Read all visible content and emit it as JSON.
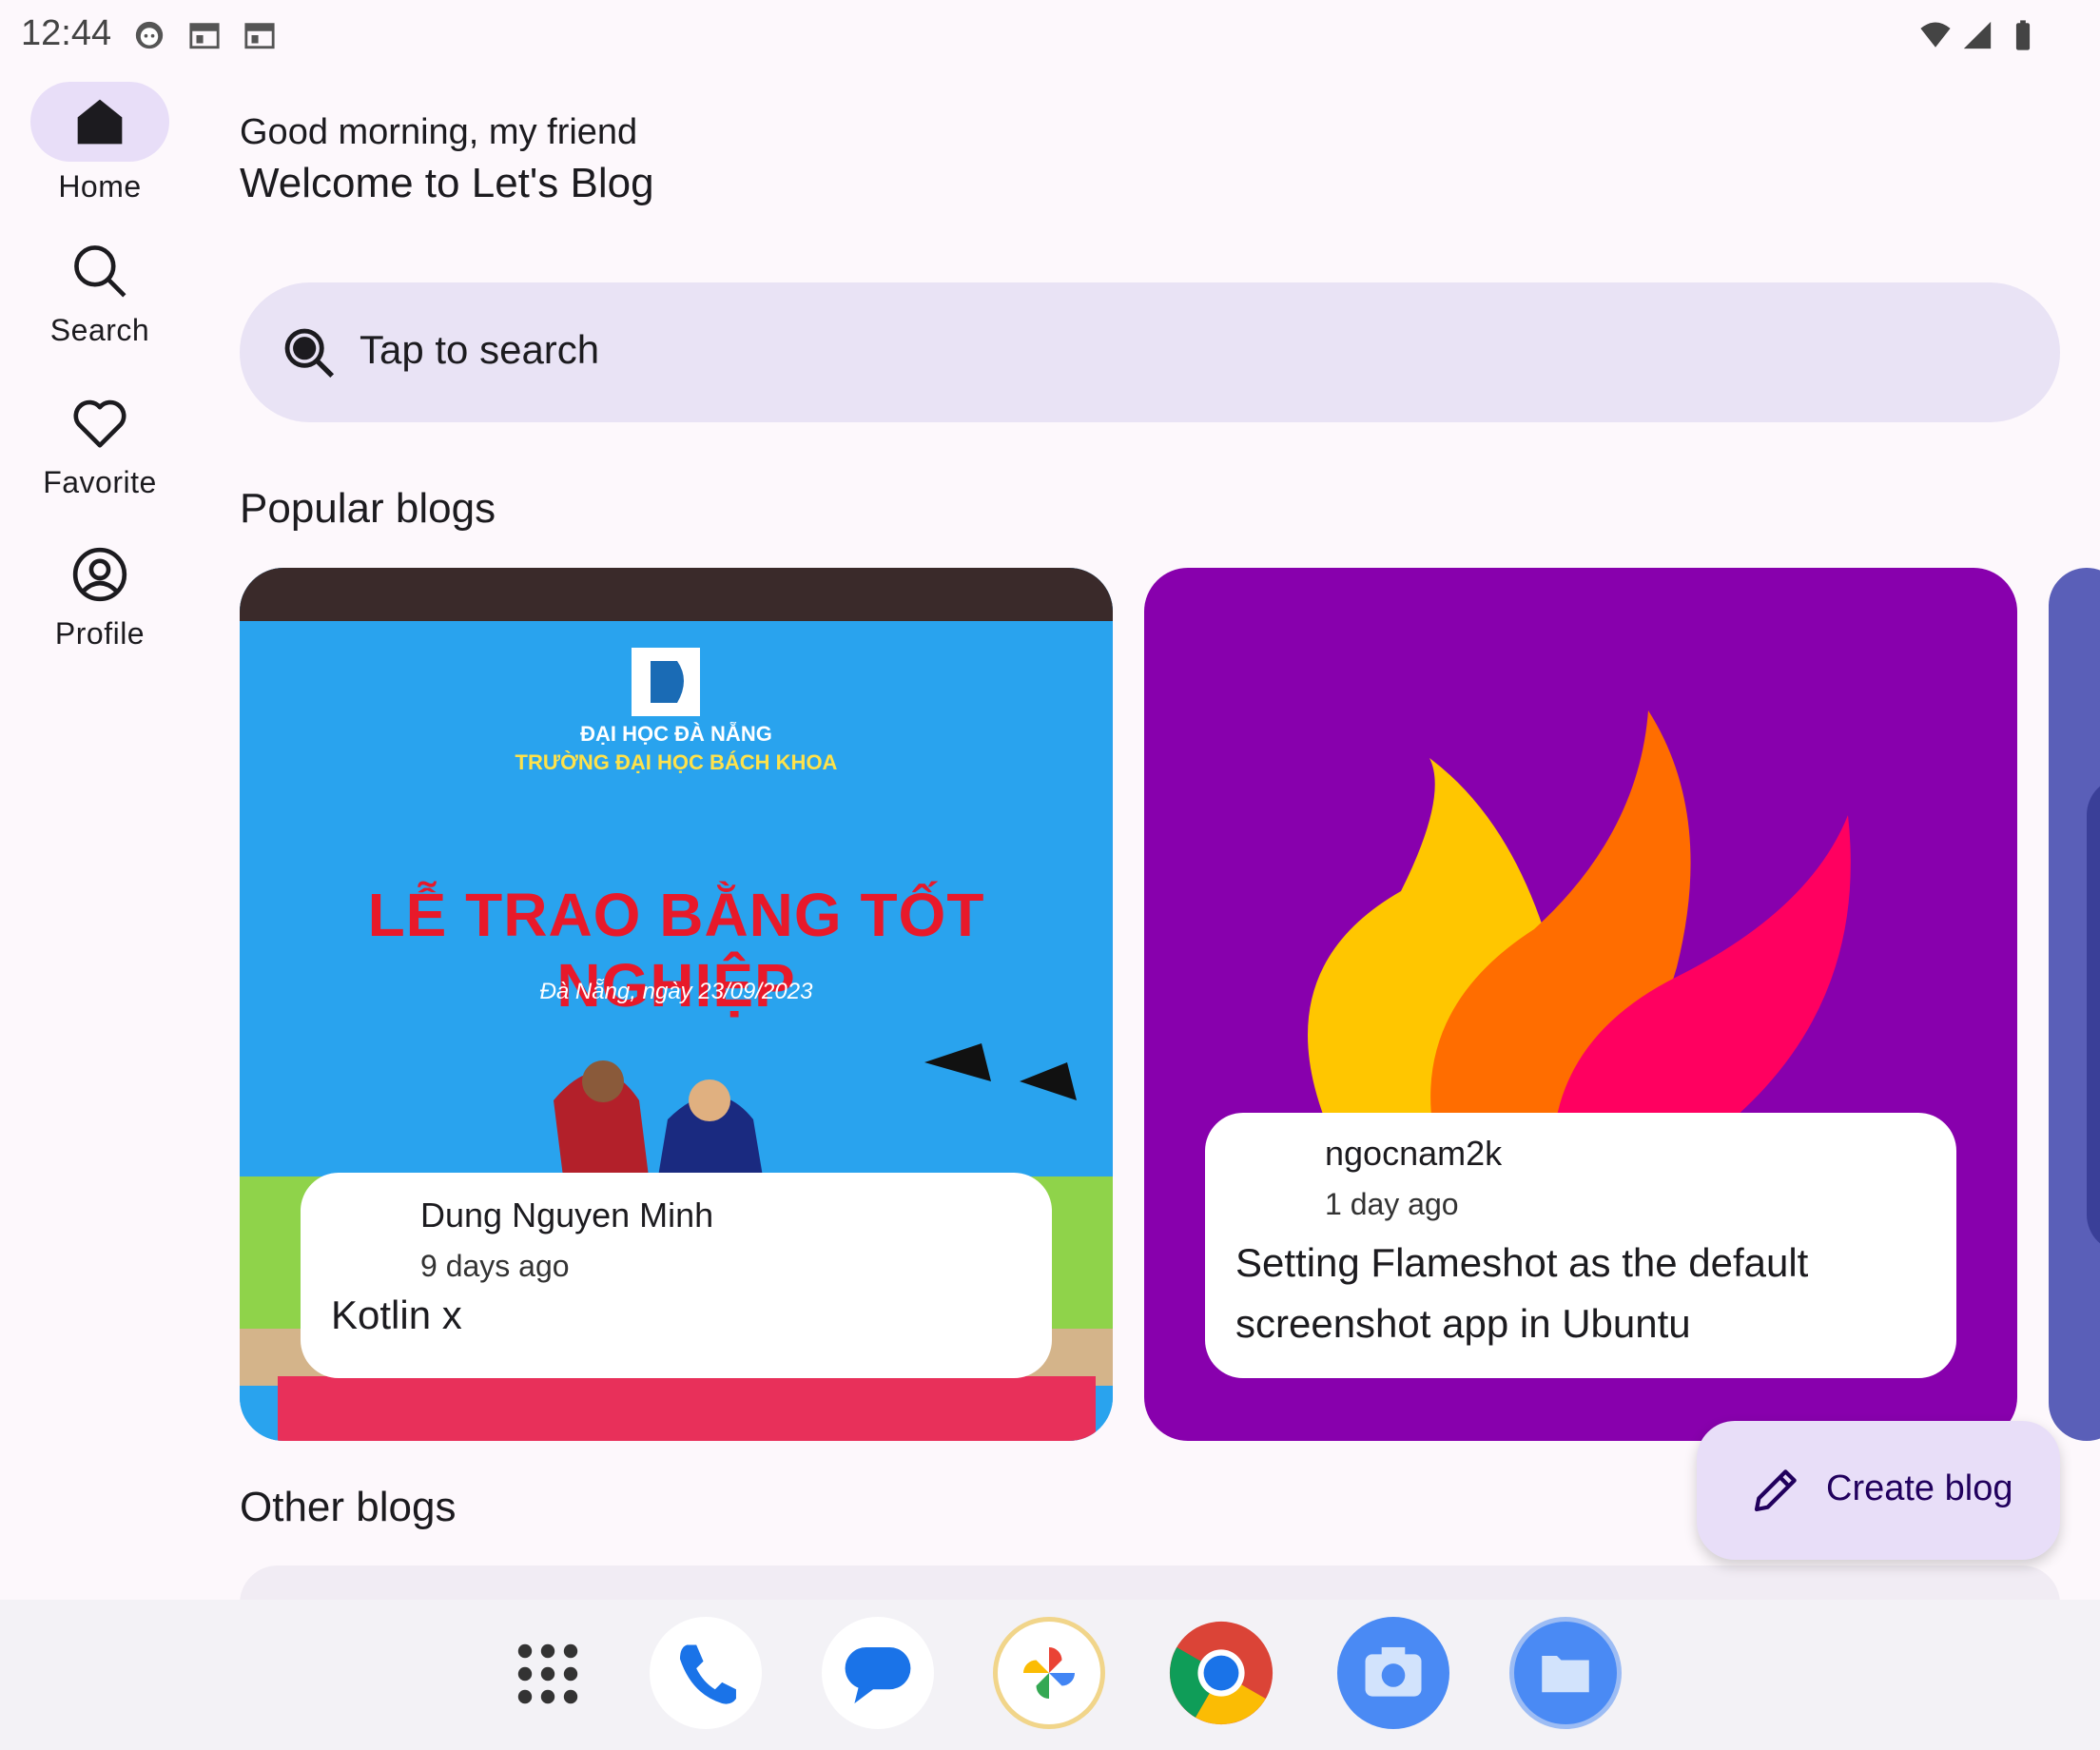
{
  "status_bar": {
    "time": "12:44",
    "icons": [
      "face-icon",
      "calendar-icon",
      "calendar-icon",
      "wifi-icon",
      "signal-icon",
      "battery-icon"
    ]
  },
  "nav": {
    "items": [
      {
        "label": "Home",
        "icon": "home-icon",
        "active": true
      },
      {
        "label": "Search",
        "icon": "search-icon"
      },
      {
        "label": "Favorite",
        "icon": "heart-icon"
      },
      {
        "label": "Profile",
        "icon": "profile-icon"
      }
    ]
  },
  "header": {
    "greeting": "Good morning, my friend",
    "welcome": "Welcome to Let's Blog"
  },
  "search": {
    "placeholder": "Tap to search"
  },
  "sections": {
    "popular": "Popular blogs",
    "other": "Other blogs"
  },
  "popular_blogs": [
    {
      "author": "Dung Nguyen Minh",
      "time_ago": "9 days ago",
      "title": "Kotlin x",
      "image": {
        "org_line1": "ĐẠI HỌC ĐÀ NẴNG",
        "org_line2": "TRƯỜNG ĐẠI HỌC BÁCH KHOA",
        "headline": "LỄ TRAO BẰNG TỐT NGHIỆP",
        "date_line": "Đà Nẵng, ngày 23/09/2023"
      }
    },
    {
      "author": "ngocnam2k",
      "time_ago": "1 day ago",
      "title_line1": "Setting Flameshot as the default",
      "title_line2": "screenshot app in Ubuntu"
    }
  ],
  "fab": {
    "label": "Create blog",
    "icon": "pencil-icon"
  },
  "dock": {
    "apps": [
      "apps-grid-icon",
      "phone-icon",
      "messages-icon",
      "photos-icon",
      "chrome-icon",
      "camera-icon",
      "files-icon"
    ]
  },
  "colors": {
    "accent_bg": "#e8def8",
    "search_bg": "#e9e3f5",
    "flameshot_purple": "#8800ad"
  }
}
